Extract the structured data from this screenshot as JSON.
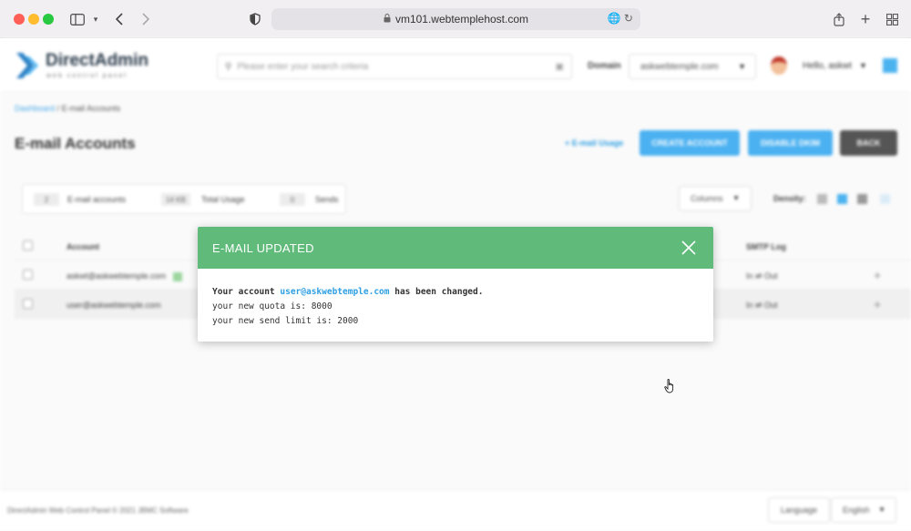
{
  "browser": {
    "url": "vm101.webtemplehost.com",
    "sidebar_icon": "sidebar-icon",
    "back_icon": "chevron-left-icon",
    "forward_icon": "chevron-right-icon",
    "shield_icon": "shield-icon",
    "share_icon": "share-icon",
    "newtab_icon": "plus-icon",
    "tabs_icon": "tabs-grid-icon"
  },
  "modal": {
    "title": "E-MAIL UPDATED",
    "line1_prefix": "Your account",
    "line1_email": "user@askwebtemple.com",
    "line1_suffix": "has been changed.",
    "line2_prefix": "your new quota is:",
    "line2_value": "8000",
    "line3_prefix": "your new send limit is:",
    "line3_value": "2000"
  },
  "app": {
    "brand": {
      "name": "DirectAdmin",
      "tagline": "web control panel"
    },
    "search": {
      "placeholder": "Please enter your search criteria"
    },
    "domain": {
      "label": "Domain",
      "value": "askwebtemple.com"
    },
    "user": {
      "greeting": "Hello, askwt"
    },
    "breadcrumb": {
      "home": "Dashboard",
      "sep": "/",
      "current": "E-mail Accounts"
    },
    "page": {
      "title": "E-mail Accounts",
      "usage_link": "+ E-mail Usage",
      "create_button": "CREATE ACCOUNT",
      "disable_button": "DISABLE DKIM",
      "back_button": "BACK"
    },
    "stats": {
      "accounts_count": "2",
      "accounts_label": "E-mail accounts",
      "usage_value": "14 KB",
      "usage_label": "Total Usage",
      "sends_value": "0",
      "sends_label": "Sends"
    },
    "controls": {
      "columns": "Columns",
      "density": "Density:"
    },
    "table": {
      "headers": {
        "account": "Account",
        "smtp": "SMTP Log"
      },
      "rows": [
        {
          "account": "askwt@askwebtemple.com",
          "smtp": "In ⇌ Out"
        },
        {
          "account": "user@askwebtemple.com",
          "smtp": "In ⇌ Out"
        }
      ]
    },
    "footer": {
      "copyright": "DirectAdmin Web Control Panel © 2021 JBMC Software",
      "language_button": "Language",
      "language_value": "English"
    }
  }
}
